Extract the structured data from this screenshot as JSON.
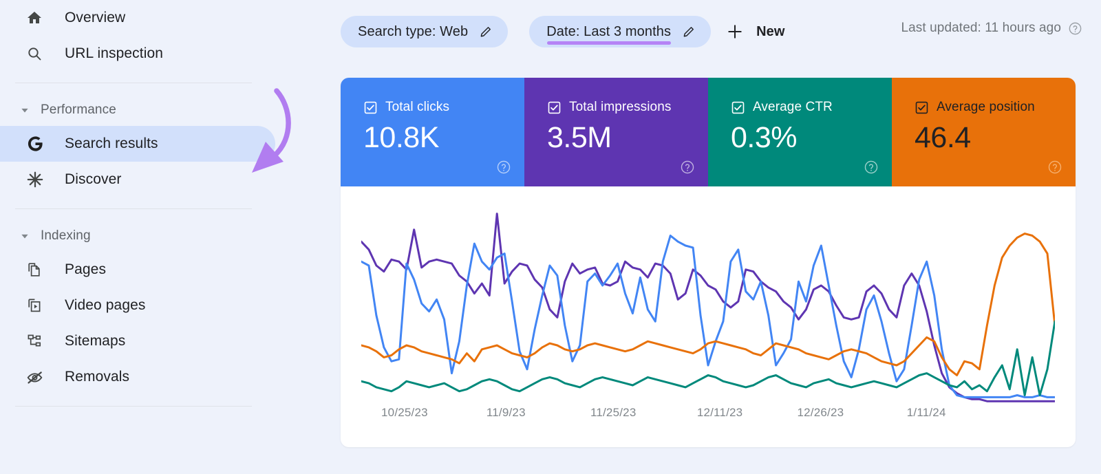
{
  "sidebar": {
    "items": [
      {
        "label": "Overview",
        "icon": "home-icon",
        "name": "sidebar-item-overview",
        "active": false
      },
      {
        "label": "URL inspection",
        "icon": "search-icon",
        "name": "sidebar-item-url-inspection",
        "active": false
      }
    ],
    "sections": [
      {
        "title": "Performance",
        "name": "sidebar-section-performance",
        "items": [
          {
            "label": "Search results",
            "icon": "google-g-icon",
            "name": "sidebar-item-search-results",
            "active": true
          },
          {
            "label": "Discover",
            "icon": "discover-icon",
            "name": "sidebar-item-discover",
            "active": false
          }
        ]
      },
      {
        "title": "Indexing",
        "name": "sidebar-section-indexing",
        "items": [
          {
            "label": "Pages",
            "icon": "pages-icon",
            "name": "sidebar-item-pages",
            "active": false
          },
          {
            "label": "Video pages",
            "icon": "video-icon",
            "name": "sidebar-item-video-pages",
            "active": false
          },
          {
            "label": "Sitemaps",
            "icon": "sitemap-icon",
            "name": "sidebar-item-sitemaps",
            "active": false
          },
          {
            "label": "Removals",
            "icon": "eye-off-icon",
            "name": "sidebar-item-removals",
            "active": false
          }
        ]
      }
    ]
  },
  "toolbar": {
    "chips": [
      {
        "label": "Search type: Web",
        "name": "filter-chip-search-type",
        "underlined": false
      },
      {
        "label": "Date: Last 3 months",
        "name": "filter-chip-date",
        "underlined": true
      }
    ],
    "new_label": "New",
    "last_updated": "Last updated: 11 hours ago"
  },
  "metrics": [
    {
      "label": "Total clicks",
      "value": "10.8K",
      "color": "#4285f4",
      "text": "light",
      "name": "metric-card-total-clicks",
      "checked": true
    },
    {
      "label": "Total impressions",
      "value": "3.5M",
      "color": "#5e35b1",
      "text": "light",
      "name": "metric-card-total-impressions",
      "checked": true
    },
    {
      "label": "Average CTR",
      "value": "0.3%",
      "color": "#00897b",
      "text": "light",
      "name": "metric-card-average-ctr",
      "checked": true
    },
    {
      "label": "Average position",
      "value": "46.4",
      "color": "#e8710a",
      "text": "dark",
      "name": "metric-card-average-position",
      "checked": true
    }
  ],
  "annotation": {
    "name": "curved-arrow-annotation",
    "color": "#b17df0"
  },
  "chart_data": {
    "type": "line",
    "title": "",
    "xlabel": "",
    "ylabel": "",
    "grid": false,
    "legend": "none",
    "x_tick_labels": [
      "10/25/23",
      "11/9/23",
      "11/25/23",
      "12/11/23",
      "12/26/23",
      "1/11/24"
    ],
    "x_tick_positions_pct": [
      8.7,
      22.5,
      37.1,
      51.6,
      65.3,
      79.7
    ],
    "n_points": 93,
    "series": [
      {
        "name": "Total impressions",
        "color": "#5e35b1",
        "values": [
          82,
          78,
          70,
          67,
          73,
          72,
          68,
          88,
          69,
          72,
          73,
          72,
          71,
          65,
          62,
          56,
          61,
          55,
          96,
          61,
          67,
          71,
          70,
          63,
          59,
          48,
          44,
          62,
          71,
          66,
          68,
          69,
          61,
          60,
          62,
          72,
          69,
          68,
          64,
          71,
          70,
          66,
          53,
          56,
          68,
          65,
          60,
          58,
          52,
          49,
          52,
          68,
          67,
          62,
          59,
          57,
          52,
          49,
          43,
          48,
          58,
          60,
          57,
          50,
          44,
          43,
          44,
          57,
          60,
          56,
          48,
          44,
          60,
          66,
          60,
          47,
          30,
          16,
          9,
          6,
          4,
          3,
          3,
          2,
          2,
          2,
          2,
          2,
          2,
          2,
          2,
          2,
          2
        ]
      },
      {
        "name": "Total clicks",
        "color": "#4285f4",
        "values": [
          72,
          70,
          45,
          29,
          22,
          23,
          71,
          63,
          51,
          47,
          53,
          43,
          16,
          32,
          60,
          81,
          72,
          68,
          74,
          76,
          52,
          27,
          18,
          38,
          55,
          70,
          65,
          40,
          22,
          30,
          62,
          66,
          60,
          65,
          71,
          56,
          46,
          64,
          48,
          42,
          72,
          85,
          82,
          80,
          79,
          45,
          20,
          32,
          42,
          72,
          78,
          57,
          53,
          62,
          45,
          20,
          26,
          33,
          62,
          52,
          70,
          80,
          60,
          40,
          22,
          14,
          28,
          48,
          55,
          42,
          26,
          12,
          18,
          40,
          63,
          72,
          55,
          28,
          10,
          5,
          4,
          4,
          4,
          4,
          4,
          4,
          4,
          5,
          4,
          4,
          5,
          4,
          4
        ]
      },
      {
        "name": "Average position",
        "color": "#e8710a",
        "values": [
          30,
          29,
          27,
          24,
          25,
          28,
          30,
          29,
          27,
          26,
          25,
          24,
          23,
          21,
          26,
          22,
          28,
          29,
          30,
          28,
          26,
          25,
          24,
          26,
          29,
          31,
          30,
          28,
          27,
          28,
          30,
          31,
          30,
          29,
          28,
          27,
          28,
          30,
          32,
          31,
          30,
          29,
          28,
          27,
          26,
          28,
          31,
          32,
          31,
          30,
          29,
          28,
          26,
          25,
          28,
          31,
          30,
          29,
          28,
          26,
          25,
          24,
          23,
          25,
          27,
          28,
          27,
          26,
          24,
          22,
          21,
          20,
          22,
          26,
          30,
          34,
          32,
          24,
          18,
          15,
          22,
          21,
          18,
          40,
          60,
          74,
          80,
          84,
          86,
          85,
          82,
          76,
          40
        ]
      },
      {
        "name": "Average CTR",
        "color": "#00897b",
        "values": [
          12,
          11,
          9,
          8,
          7,
          9,
          12,
          11,
          10,
          9,
          10,
          11,
          9,
          7,
          8,
          10,
          12,
          13,
          12,
          10,
          8,
          7,
          9,
          11,
          13,
          14,
          13,
          11,
          10,
          9,
          11,
          13,
          14,
          13,
          12,
          11,
          10,
          12,
          14,
          13,
          12,
          11,
          10,
          9,
          11,
          13,
          15,
          14,
          12,
          11,
          10,
          9,
          10,
          12,
          14,
          15,
          13,
          11,
          10,
          9,
          11,
          12,
          13,
          11,
          10,
          9,
          10,
          11,
          12,
          11,
          10,
          9,
          11,
          13,
          15,
          16,
          14,
          12,
          10,
          9,
          12,
          8,
          10,
          7,
          14,
          20,
          8,
          28,
          5,
          24,
          5,
          18,
          42
        ]
      }
    ]
  }
}
